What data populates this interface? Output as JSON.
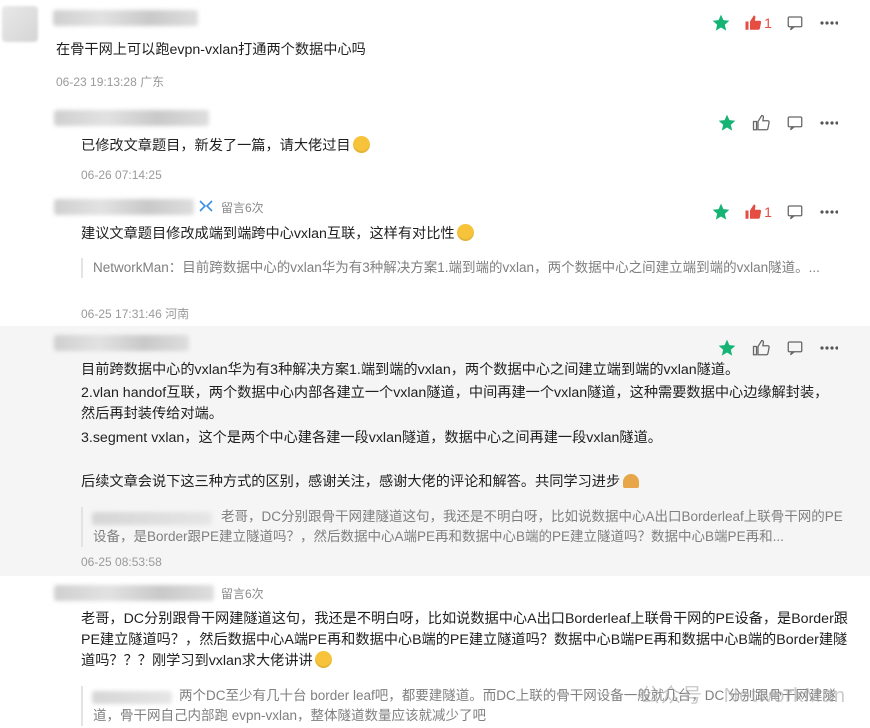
{
  "colors": {
    "star": "#15b374",
    "like_active": "#e54d42",
    "icon_gray": "#666666"
  },
  "comments": [
    {
      "text": "在骨干网上可以跑evpn-vxlan打通两个数据中心吗",
      "meta": "06-23 19:13:28 广东",
      "likes": "1"
    },
    {
      "text": "已修改文章题目，新发了一篇，请大佬过目",
      "meta": "06-26 07:14:25"
    },
    {
      "tag": "留言6次",
      "text": "建议文章题目修改成端到端跨中心vxlan互联，这样有对比性",
      "quote": "NetworkMan：目前跨数据中心的vxlan华为有3种解决方案1.端到端的vxlan，两个数据中心之间建立端到端的vxlan隧道。...",
      "meta": "06-25 17:31:46 河南",
      "likes": "1"
    },
    {
      "lines": [
        "目前跨数据中心的vxlan华为有3种解决方案1.端到端的vxlan，两个数据中心之间建立端到端的vxlan隧道。",
        "2.vlan  handof互联，两个数据中心内部各建立一个vxlan隧道，中间再建一个vxlan隧道，这种需要数据中心边缘解封装，",
        "然后再封装传给对端。",
        "3.segment vxlan，这个是两个中心建各建一段vxlan隧道，数据中心之间再建一段vxlan隧道。",
        "后续文章会说下这三种方式的区别，感谢关注，感谢大佬的评论和解答。共同学习进步"
      ],
      "quote": "老哥，DC分别跟骨干网建隧道这句，我还是不明白呀，比如说数据中心A出口Borderleaf上联骨干网的PE设备，是Border跟PE建立隧道吗？，然后数据中心A端PE再和数据中心B端的PE建立隧道吗？数据中心B端PE再和...",
      "meta": "06-25 08:53:58"
    },
    {
      "tag": "留言6次",
      "text": "老哥，DC分别跟骨干网建隧道这句，我还是不明白呀，比如说数据中心A出口Borderleaf上联骨干网的PE设备，是Border跟PE建立隧道吗？，然后数据中心A端PE再和数据中心B端的PE建立隧道吗？数据中心B端PE再和数据中心B端的Border建隧道吗？？？刚学习到vxlan求大佬讲讲",
      "quote": "两个DC至少有几十台 border leaf吧，都要建隧道。而DC上联的骨干网设备一般就几台，DC 分别跟骨干网建隧道，骨干网自己内部跑 evpn-vxlan，整体隧道数量应该就减少了吧"
    }
  ],
  "watermark": "公众号 · NetworkMan"
}
